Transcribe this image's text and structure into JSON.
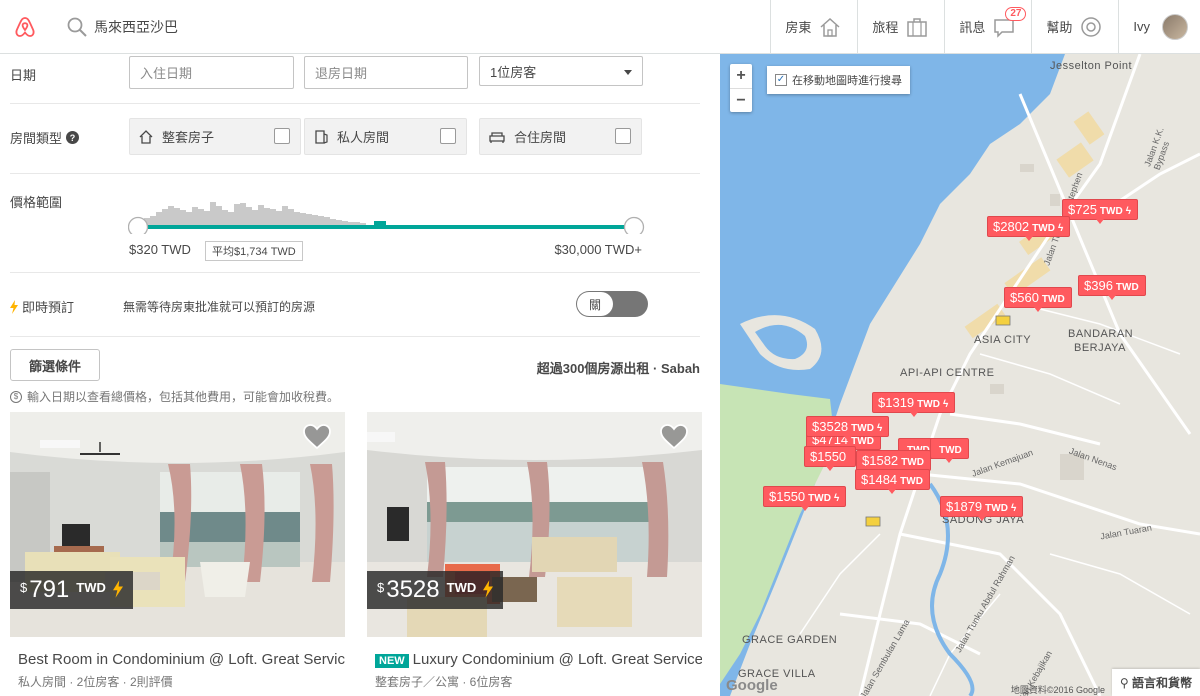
{
  "header": {
    "search_text": "馬來西亞沙巴",
    "nav": {
      "host": "房東",
      "trips": "旅程",
      "messages": "訊息",
      "messages_badge": "27",
      "help": "幫助",
      "user": "Ivy"
    }
  },
  "filters": {
    "dates_label": "日期",
    "checkin_placeholder": "入住日期",
    "checkout_placeholder": "退房日期",
    "guests_value": "1位房客",
    "room_type_label": "房間類型",
    "room_types": [
      "整套房子",
      "私人房間",
      "合住房間"
    ],
    "price_label": "價格範圍",
    "price_min": "$320 TWD",
    "price_avg": "平均$1,734 TWD",
    "price_max": "$30,000 TWD+",
    "instant_label": "即時預訂",
    "instant_desc": "無需等待房東批准就可以預訂的房源",
    "instant_toggle": "關"
  },
  "results": {
    "filter_button": "篩選條件",
    "count_text": "超過300個房源出租 · Sabah",
    "notice": "輸入日期以查看總價格，包括其他費用，可能會加收稅費。"
  },
  "listings": [
    {
      "currency": "$",
      "price": "791",
      "unit": "TWD",
      "title": "Best Room in Condominium @ Loft. Great Services",
      "subtitle": "私人房間 · 2位房客 · 2則評價",
      "is_new": false
    },
    {
      "currency": "$",
      "price": "3528",
      "unit": "TWD",
      "new_label": "NEW",
      "title": "Luxury Condominium @ Loft. Great Services",
      "subtitle": "整套房子／公寓 · 6位房客",
      "is_new": true
    }
  ],
  "map": {
    "zoom_in": "+",
    "zoom_out": "−",
    "search_toggle": "在移動地圖時進行搜尋",
    "pins": [
      {
        "amount": "$725",
        "unit": "TWD"
      },
      {
        "amount": "$2802",
        "unit": "TWD"
      },
      {
        "amount": "$560",
        "unit": "TWD"
      },
      {
        "amount": "$396",
        "unit": "TWD"
      },
      {
        "amount": "$1319",
        "unit": "TWD"
      },
      {
        "amount": "$3528",
        "unit": "TWD"
      },
      {
        "amount": "$4714",
        "unit": "TWD"
      },
      {
        "amount": "$1550",
        "unit": ""
      },
      {
        "amount": "$1582",
        "unit": "TWD"
      },
      {
        "amount": "$1484",
        "unit": "TWD"
      },
      {
        "amount": "$1550",
        "unit": "TWD"
      },
      {
        "amount": "$1879",
        "unit": "TWD"
      },
      {
        "amount": "",
        "unit": "TWD"
      },
      {
        "amount": "",
        "unit": "TWD"
      }
    ],
    "labels": {
      "jesselton": "Jesselton Point",
      "asia_city": "ASIA CITY",
      "bandaran": "BANDARAN",
      "berjaya": "BERJAYA",
      "api_api": "API-API CENTRE",
      "sadong_jaya": "SADONG JAYA",
      "grace_garden": "GRACE GARDEN",
      "grace_villa": "GRACE VILLA",
      "road1": "Jalan K.K. Bypass",
      "road2": "Jalan Tun Fuad Stephen",
      "road3": "Jalan Nenas",
      "road4": "Jalan Tuaran",
      "road5": "Jalan Tunku Abdul Rahman",
      "road6": "Jalan Sembulan Lama",
      "road7": "Jalan Kemajuan",
      "road8": "Jalan Kebajikan",
      "road9": "Jalan Tun Razak"
    },
    "lang_button": "語言和貨幣",
    "attribution": "地圖資料©2016 Google",
    "google": "Google"
  },
  "colors": {
    "brand": "#ff5a5f",
    "teal": "#00a699",
    "water": "#7fb6e8",
    "land": "#e8e6df"
  }
}
